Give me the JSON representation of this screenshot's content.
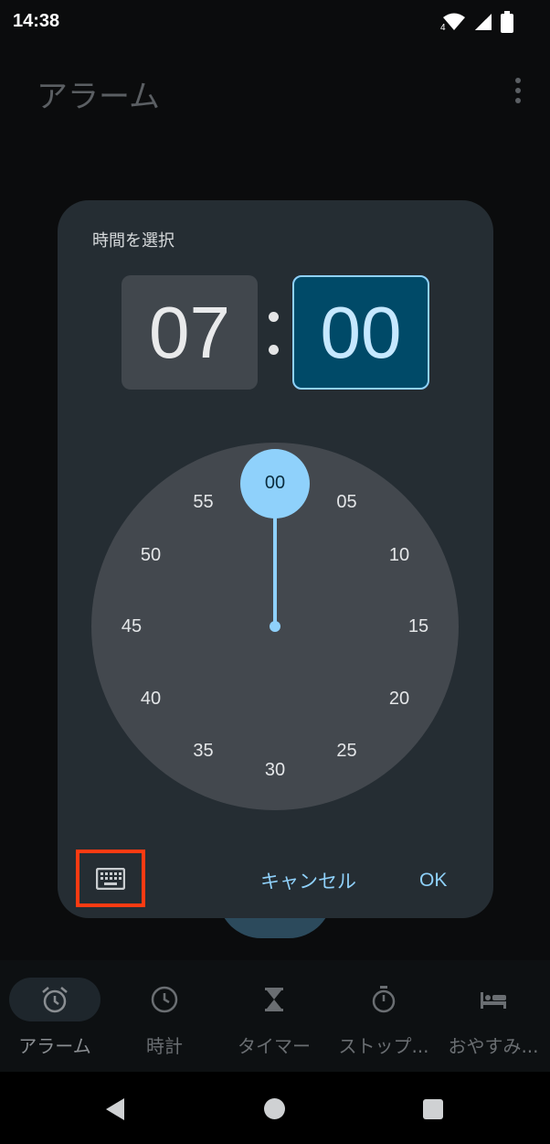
{
  "status_bar": {
    "time": "14:38",
    "network_badge": "4",
    "icons": [
      "wifi-icon",
      "signal-icon",
      "battery-icon"
    ]
  },
  "app_bar": {
    "title": "アラーム",
    "menu_icon": "more-vert-icon"
  },
  "dialog": {
    "title": "時間を選択",
    "hour": "07",
    "separator": ":",
    "minute": "00",
    "selected_field": "minute",
    "dial_numbers": [
      "00",
      "05",
      "10",
      "15",
      "20",
      "25",
      "30",
      "35",
      "40",
      "45",
      "50",
      "55"
    ],
    "selected_value": "00",
    "keyboard_icon": "keyboard-icon",
    "cancel_label": "キャンセル",
    "ok_label": "OK"
  },
  "bottom_nav": {
    "items": [
      {
        "label": "アラーム",
        "icon": "alarm-clock-icon",
        "active": true
      },
      {
        "label": "時計",
        "icon": "clock-icon",
        "active": false
      },
      {
        "label": "タイマー",
        "icon": "hourglass-icon",
        "active": false
      },
      {
        "label": "ストップ...",
        "icon": "stopwatch-icon",
        "active": false
      },
      {
        "label": "おやすみ...",
        "icon": "bed-icon",
        "active": false
      }
    ]
  },
  "system_nav": [
    "back-icon",
    "home-icon",
    "recents-icon"
  ],
  "colors": {
    "accent": "#8fd1fb",
    "dialog_background": "#252d33",
    "minute_selected_background": "#004a68",
    "highlight_frame": "#ff3b12"
  }
}
